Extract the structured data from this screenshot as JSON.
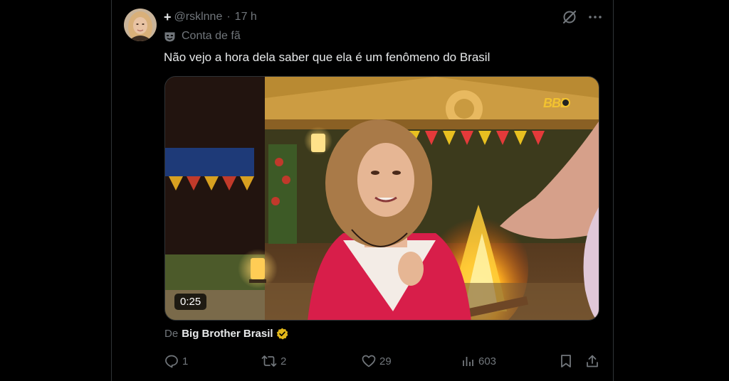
{
  "post": {
    "plus_symbol": "+",
    "handle": "@rsklnne",
    "separator": "·",
    "time": "17 h",
    "fan_label": "Conta de fã",
    "text": "Não vejo a hora dela saber que ela é um fenômeno do Brasil",
    "avatar_icon": "user-avatar"
  },
  "media": {
    "duration": "0:25",
    "logo_text": "BBB"
  },
  "source": {
    "prefix": "De",
    "name": "Big Brother Brasil",
    "badge_color": "#e2b719"
  },
  "actions": {
    "replies": "1",
    "reposts": "2",
    "likes": "29",
    "views": "603"
  },
  "colors": {
    "background": "#000000",
    "text_primary": "#e7e9ea",
    "text_secondary": "#71767b",
    "border": "#2f3336"
  }
}
